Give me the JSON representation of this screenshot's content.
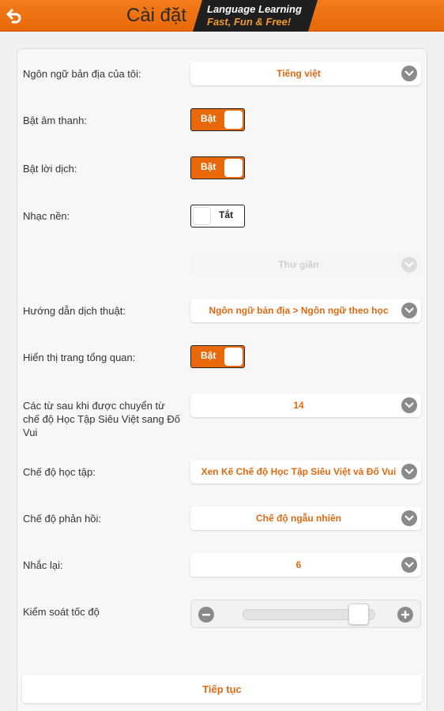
{
  "header": {
    "title": "Cài đặt",
    "brand_line1": "Language Learning",
    "brand_line2": "Fast, Fun & Free!",
    "bar_color": "#e8680a",
    "back_icon": "back-arrow-icon"
  },
  "settings": {
    "native_language": {
      "label": "Ngôn ngữ bản địa của tôi:",
      "value": "Tiếng việt"
    },
    "sound": {
      "label": "Bật âm thanh:",
      "state": "Bật"
    },
    "translation": {
      "label": "Bật lời dịch:",
      "state": "Bật"
    },
    "music": {
      "label": "Nhạc nền:",
      "state": "Tắt"
    },
    "music_track": {
      "value": "Thư giãn"
    },
    "translation_direction": {
      "label": "Hướng dẫn dịch thuật:",
      "value": "Ngôn ngữ bản địa > Ngôn ngữ theo học"
    },
    "overview": {
      "label": "Hiển thị trang tổng quan:",
      "state": "Bật"
    },
    "words_after": {
      "label": "Các từ sau khi được chuyển từ chế độ Học Tập Siêu Việt sang Đố Vui",
      "value": "14"
    },
    "study_mode": {
      "label": "Chế độ học tập:",
      "value": "Xen Kẽ Chế độ Học Tập Siêu Việt và Đố Vui"
    },
    "feedback_mode": {
      "label": "Chế độ phản hồi:",
      "value": "Chế độ ngẫu nhiên"
    },
    "repeat": {
      "label": "Nhắc lại:",
      "value": "6"
    },
    "speed": {
      "label": "Kiểm soát tốc độ",
      "level": 0.9
    }
  },
  "footer": {
    "continue_label": "Tiếp tục"
  },
  "accent_color": "#e06a12"
}
